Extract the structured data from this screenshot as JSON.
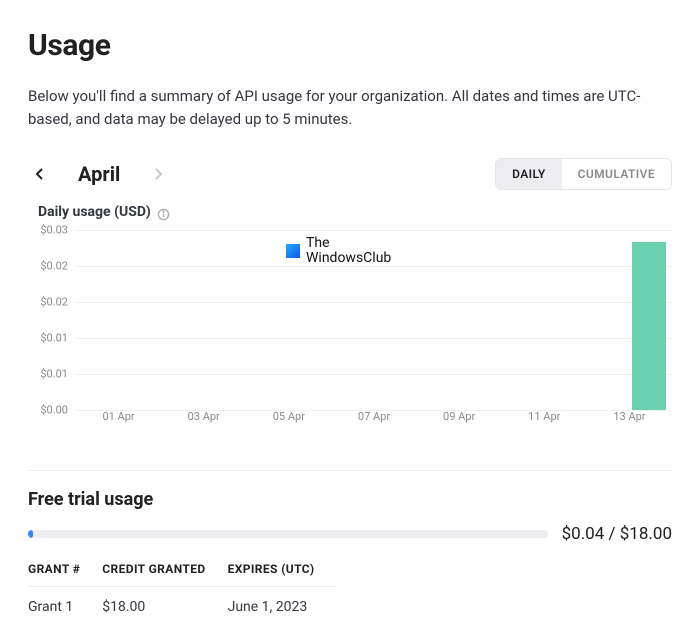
{
  "page": {
    "title": "Usage",
    "description": "Below you'll find a summary of API usage for your organization. All dates and times are UTC-based, and data may be delayed up to 5 minutes."
  },
  "month_nav": {
    "month": "April"
  },
  "view_toggle": {
    "daily": "DAILY",
    "cumulative": "CUMULATIVE",
    "active": "daily"
  },
  "chart": {
    "title": "Daily usage (USD)",
    "y_ticks": [
      "$0.03",
      "$0.02",
      "$0.02",
      "$0.01",
      "$0.01",
      "$0.00"
    ],
    "x_ticks": [
      "01 Apr",
      "03 Apr",
      "05 Apr",
      "07 Apr",
      "09 Apr",
      "11 Apr",
      "13 Apr"
    ]
  },
  "chart_data": {
    "type": "bar",
    "title": "Daily usage (USD)",
    "xlabel": "",
    "ylabel": "USD",
    "ylim": [
      0,
      0.03
    ],
    "categories": [
      "01 Apr",
      "02 Apr",
      "03 Apr",
      "04 Apr",
      "05 Apr",
      "06 Apr",
      "07 Apr",
      "08 Apr",
      "09 Apr",
      "10 Apr",
      "11 Apr",
      "12 Apr",
      "13 Apr"
    ],
    "values": [
      0,
      0,
      0,
      0,
      0,
      0,
      0,
      0,
      0,
      0,
      0,
      0,
      0.028
    ]
  },
  "watermark": {
    "line1": "The",
    "line2": "WindowsClub"
  },
  "free_trial": {
    "heading": "Free trial usage",
    "used_label": "$0.04 / $18.00",
    "used": 0.04,
    "total": 18.0,
    "columns": {
      "grant": "GRANT #",
      "credit": "CREDIT GRANTED",
      "expires": "EXPIRES (UTC)"
    },
    "rows": [
      {
        "grant": "Grant 1",
        "credit": "$18.00",
        "expires": "June 1, 2023"
      }
    ]
  }
}
